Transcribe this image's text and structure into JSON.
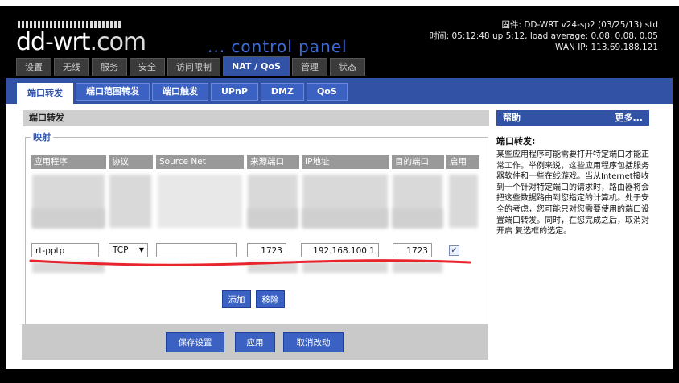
{
  "logo": {
    "brand_main": "dd-wrt",
    "brand_suffix": ".com",
    "tagline": "... control panel"
  },
  "firmware": {
    "version_line": "固件: DD-WRT v24-sp2 (03/25/13) std",
    "uptime_line": "时间: 05:12:48 up 5:12, load average: 0.08, 0.08, 0.05",
    "wan_ip_line": "WAN IP: 113.69.188.121"
  },
  "main_tabs": [
    {
      "label": "设置",
      "active": false
    },
    {
      "label": "无线",
      "active": false
    },
    {
      "label": "服务",
      "active": false
    },
    {
      "label": "安全",
      "active": false
    },
    {
      "label": "访问限制",
      "active": false
    },
    {
      "label": "NAT / QoS",
      "active": true
    },
    {
      "label": "管理",
      "active": false
    },
    {
      "label": "状态",
      "active": false
    }
  ],
  "sub_tabs": [
    {
      "label": "端口转发",
      "active": true
    },
    {
      "label": "端口范围转发",
      "active": false
    },
    {
      "label": "端口触发",
      "active": false
    },
    {
      "label": "UPnP",
      "active": false
    },
    {
      "label": "DMZ",
      "active": false
    },
    {
      "label": "QoS",
      "active": false
    }
  ],
  "panel": {
    "title": "端口转发",
    "section_legend": "映射",
    "columns": [
      "应用程序",
      "协议",
      "Source Net",
      "来源端口",
      "IP地址",
      "目的端口",
      "启用"
    ]
  },
  "rule": {
    "application": "rt-pptp",
    "protocol": "TCP",
    "source_net": "",
    "source_port": "1723",
    "ip_address": "192.168.100.1",
    "dest_port": "1723",
    "enabled": true,
    "check_glyph": "✓"
  },
  "buttons": {
    "add": "添加",
    "remove": "移除",
    "save": "保存设置",
    "apply": "应用",
    "cancel": "取消改动"
  },
  "help": {
    "header": "帮助",
    "more": "更多...",
    "title": "端口转发:",
    "body": "某些应用程序可能需要打开特定端口才能正常工作。举例来说，这些应用程序包括服务器软件和一些在线游戏。当从Internet接收到一个针对特定端口的请求时，路由器将会把这些数据路由到您指定的计算机。处于安全的考虑，您可能只对您需要使用的端口设置端口转发。同时，在您完成之后，取消对 开启 复选框的选定。"
  },
  "colors": {
    "nav_blue": "#3152a5",
    "header_black": "#000000",
    "annotation_red": "#e8242c"
  }
}
